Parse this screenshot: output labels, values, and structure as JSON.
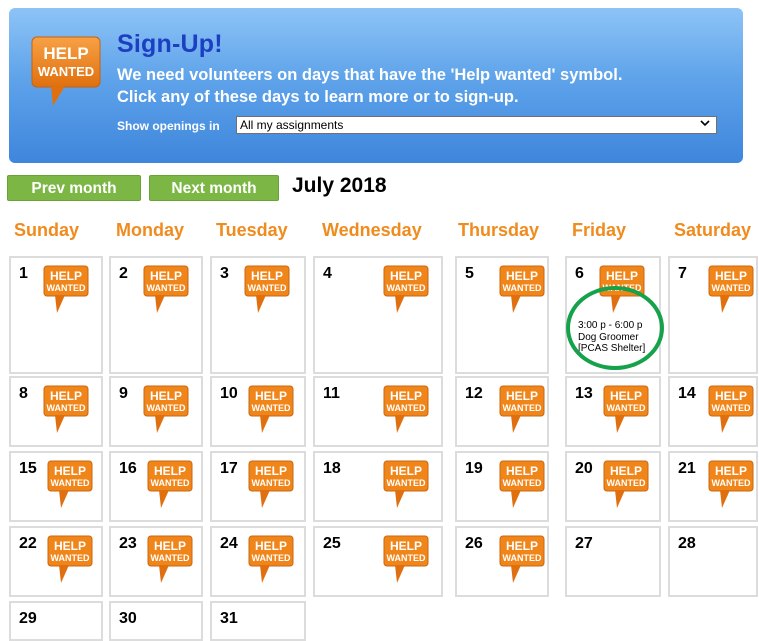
{
  "banner": {
    "badge_line1": "HELP",
    "badge_line2": "WANTED",
    "title": "Sign-Up!",
    "line1": "We need volunteers on days that have the 'Help wanted' symbol.",
    "line2": "Click any of these days to learn more or to sign-up.",
    "filter_label": "Show openings in",
    "filter_value": "All my assignments"
  },
  "nav": {
    "prev_label": "Prev month",
    "next_label": "Next month",
    "month_title": "July 2018"
  },
  "weekdays": [
    "Sunday",
    "Monday",
    "Tuesday",
    "Wednesday",
    "Thursday",
    "Friday",
    "Saturday"
  ],
  "help_badge": {
    "line1": "HELP",
    "line2": "WANTED"
  },
  "colors": {
    "badge": "#f0851a",
    "weekday": "#f08b1e",
    "nav_button": "#7cb746",
    "banner": "#4a90e2",
    "highlight": "#15a24a"
  },
  "weeks": [
    [
      {
        "day": "1",
        "help": true
      },
      {
        "day": "2",
        "help": true
      },
      {
        "day": "3",
        "help": true
      },
      {
        "day": "4",
        "help": true
      },
      {
        "day": "5",
        "help": true
      },
      {
        "day": "6",
        "help": true,
        "slot": [
          "3:00 p - 6:00 p",
          "Dog Groomer",
          "[PCAS Shelter]"
        ]
      },
      {
        "day": "7",
        "help": true
      }
    ],
    [
      {
        "day": "8",
        "help": true
      },
      {
        "day": "9",
        "help": true
      },
      {
        "day": "10",
        "help": true
      },
      {
        "day": "11",
        "help": true
      },
      {
        "day": "12",
        "help": true
      },
      {
        "day": "13",
        "help": true
      },
      {
        "day": "14",
        "help": true
      }
    ],
    [
      {
        "day": "15",
        "help": true
      },
      {
        "day": "16",
        "help": true
      },
      {
        "day": "17",
        "help": true
      },
      {
        "day": "18",
        "help": true
      },
      {
        "day": "19",
        "help": true
      },
      {
        "day": "20",
        "help": true
      },
      {
        "day": "21",
        "help": true
      }
    ],
    [
      {
        "day": "22",
        "help": true
      },
      {
        "day": "23",
        "help": true
      },
      {
        "day": "24",
        "help": true
      },
      {
        "day": "25",
        "help": true
      },
      {
        "day": "26",
        "help": true
      },
      {
        "day": "27",
        "help": false
      },
      {
        "day": "28",
        "help": false
      }
    ],
    [
      {
        "day": "29",
        "help": false
      },
      {
        "day": "30",
        "help": false
      },
      {
        "day": "31",
        "help": false
      }
    ]
  ]
}
